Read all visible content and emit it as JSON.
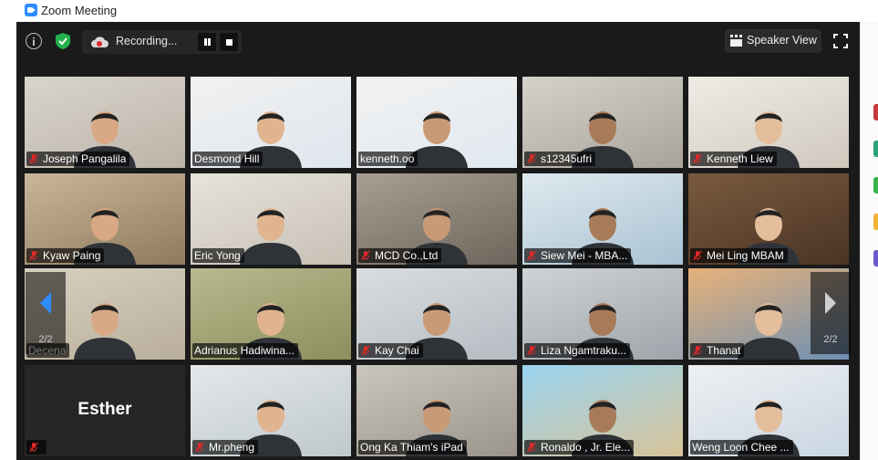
{
  "window": {
    "title": "Zoom Meeting"
  },
  "toolbar": {
    "recording_label": "Recording...",
    "view_label": "Speaker View"
  },
  "colors": {
    "accent": "#2D8CFF",
    "active_speaker": "#c9d33a",
    "shield": "#23b14d",
    "mute": "#e02828"
  },
  "pagination": {
    "left_label": "2/2",
    "right_label": "2/2"
  },
  "participants": [
    {
      "name": "Joseph Pangalila",
      "muted": true
    },
    {
      "name": "Desmond Hill",
      "muted": false
    },
    {
      "name": "kenneth.oo",
      "muted": false
    },
    {
      "name": "s12345ufri",
      "muted": true
    },
    {
      "name": "Kenneth Liew",
      "muted": true
    },
    {
      "name": "Kyaw Paing",
      "muted": true
    },
    {
      "name": "Eric Yong",
      "muted": false
    },
    {
      "name": "MCD Co.,Ltd",
      "muted": true
    },
    {
      "name": "Siew Mei - MBA...",
      "muted": true
    },
    {
      "name": "Mei Ling MBAM",
      "muted": true
    },
    {
      "name": "Decena",
      "muted": false
    },
    {
      "name": "Adrianus Hadiwina...",
      "muted": false,
      "active": true
    },
    {
      "name": "Kay Chai",
      "muted": true
    },
    {
      "name": "Liza Ngamtraku...",
      "muted": true
    },
    {
      "name": "Thanat",
      "muted": true
    },
    {
      "name": "Esther",
      "muted": true,
      "video_off": true
    },
    {
      "name": "Mr.pheng",
      "muted": true
    },
    {
      "name": "Ong Ka Thiam's iPad",
      "muted": false
    },
    {
      "name": "Ronaldo , Jr. Ele...",
      "muted": true
    },
    {
      "name": "Weng Loon Chee ...",
      "muted": false
    }
  ]
}
